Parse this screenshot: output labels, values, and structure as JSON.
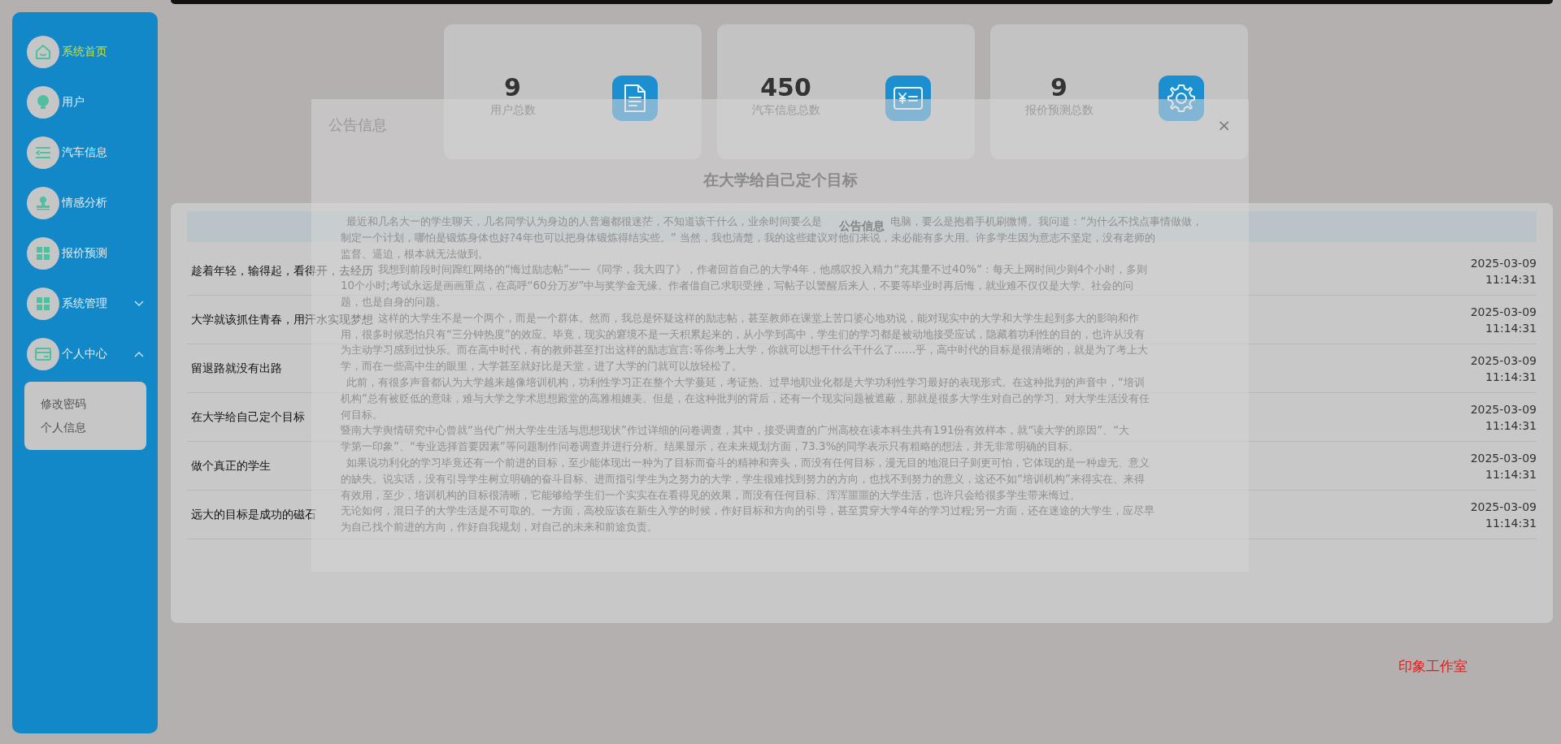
{
  "sidebar": {
    "items": [
      {
        "kind": "link",
        "label": "系统首页",
        "selected": true
      },
      {
        "kind": "link",
        "label": "用户",
        "selected": false
      },
      {
        "kind": "link",
        "label": "汽车信息",
        "selected": false
      },
      {
        "kind": "link",
        "label": "情感分析",
        "selected": false
      },
      {
        "kind": "link",
        "label": "报价预测",
        "selected": false
      },
      {
        "kind": "group",
        "label": "系统管理",
        "selected": false,
        "expanded": false
      },
      {
        "kind": "group",
        "label": "个人中心",
        "selected": false,
        "expanded": true,
        "children": [
          {
            "label": "修改密码"
          },
          {
            "label": "个人信息"
          }
        ]
      }
    ]
  },
  "stats": [
    {
      "value": "9",
      "label": "用户总数"
    },
    {
      "value": "450",
      "label": "汽车信息总数"
    },
    {
      "value": "9",
      "label": "报价预测总数"
    }
  ],
  "notices": {
    "header": "公告信息",
    "rows": [
      {
        "title": "趁着年轻，输得起，看得开，去经历",
        "time": "2025-03-09 11:14:31"
      },
      {
        "title": "大学就该抓住青春，用汗水实现梦想",
        "time": "2025-03-09 11:14:31"
      },
      {
        "title": "留退路就没有出路",
        "time": "2025-03-09 11:14:31"
      },
      {
        "title": "在大学给自己定个目标",
        "time": "2025-03-09 11:14:31"
      },
      {
        "title": "做个真正的学生",
        "time": "2025-03-09 11:14:31"
      },
      {
        "title": "远大的目标是成功的磁石",
        "time": "2025-03-09 11:14:31"
      }
    ]
  },
  "footer": "印象工作室",
  "modal": {
    "title": "公告信息",
    "close": "×",
    "article_title": "在大学给自己定个目标",
    "paragraphs": [
      {
        "kind": "indented",
        "lines": [
          [
            "最近和几名大一的学生聊天，几名同学认为身边的人普遍都很迷茫，不知道该干什么，业余时间要么是",
            "电脑，要么是抱着手机刷微博。我问道：“为什么不找点事情做做，"
          ],
          "制定一个计划，哪怕是锻炼身体也好?4年也可以把身体锻炼得结实些。” 当然，我也清楚，我的这些建议对他们来说，未必能有多大用。许多学生因为意志不坚定，没有老师的",
          "监督、逼迫，根本就无法做到。"
        ]
      },
      {
        "kind": "deep",
        "lines": [
          "我想到前段时间蹿红网络的“悔过励志帖”——《同学，我大四了》，作者回首自己的大学4年，他感叹投入精力“充其量不过40%”：每天上网时间少则4个小时，多则",
          "10个小时;考试永远是画画重点，在高呼“60分万岁”中与奖学金无缘。作者借自己求职受挫，写帖子以警醒后来人，不要等毕业时再后悔，就业难不仅仅是大学、社会的问",
          "题，也是自身的问题。"
        ]
      },
      {
        "kind": "deep",
        "lines": [
          "这样的大学生不是一个两个，而是一个群体。然而，我总是怀疑这样的励志帖，甚至教师在课堂上苦口婆心地劝说，能对现实中的大学和大学生起到多大的影响和作",
          "用，很多时候恐怕只有“三分钟热度”的效应。毕竟，现实的窘境不是一天积累起来的，从小学到高中，学生们的学习都是被动地接受应试，隐藏着功利性的目的，也许从没有",
          "为主动学习感到过快乐。而在高中时代，有的教师甚至打出这样的励志宣言:等你考上大学，你就可以想干什么干什么了……乎，高中时代的目标是很清晰的，就是为了考上大",
          "学，而在一些高中生的眼里，大学甚至就好比是天堂，进了大学的门就可以放轻松了。"
        ]
      },
      {
        "kind": "indented",
        "lines": [
          "此前，有很多声音都认为大学越来越像培训机构，功利性学习正在整个大学蔓延，考证热、过早地职业化都是大学功利性学习最好的表现形式。在这种批判的声音中，“培训",
          "机构”总有被贬低的意味，难与大学之学术思想殿堂的高雅相媲美。但是，在这种批判的背后，还有一个现实问题被遮蔽，那就是很多大学生对自己的学习、对大学生活没有任",
          "何目标。"
        ]
      },
      {
        "kind": "flush",
        "lines": [
          "暨南大学舆情研究中心曾就“当代广州大学生生活与思想现状”作过详细的问卷调查，其中，接受调查的广州高校在读本科生共有191份有效样本，就“读大学的原因”、“大",
          "学第一印象”、“专业选择首要因素”等问题制作问卷调查并进行分析。结果显示，在未来规划方面，73.3%的同学表示只有粗略的想法，并无非常明确的目标。"
        ]
      },
      {
        "kind": "indented",
        "lines": [
          "如果说功利化的学习毕竟还有一个前进的目标，至少能体现出一种为了目标而奋斗的精神和奔头，而没有任何目标，漫无目的地混日子则更可怕，它体现的是一种虚无、意义",
          "的缺失。说实话，没有引导学生树立明确的奋斗目标、进而指引学生为之努力的大学，学生很难找到努力的方向，也找不到努力的意义，这还不如“培训机构”来得实在、来得",
          "有效用，至少，培训机构的目标很清晰，它能够给学生们一个实实在在看得见的效果，而没有任何目标、浑浑噩噩的大学生活，也许只会给很多学生带来悔过。"
        ]
      },
      {
        "kind": "flush",
        "lines": [
          "无论如何，混日子的大学生活是不可取的。一方面，高校应该在新生入学的时候，作好目标和方向的引导，甚至贯穿大学4年的学习过程;另一方面，还在迷途的大学生，应尽早",
          "为自己找个前进的方向，作好自我规划，对自己的未来和前途负责。"
        ]
      }
    ]
  }
}
